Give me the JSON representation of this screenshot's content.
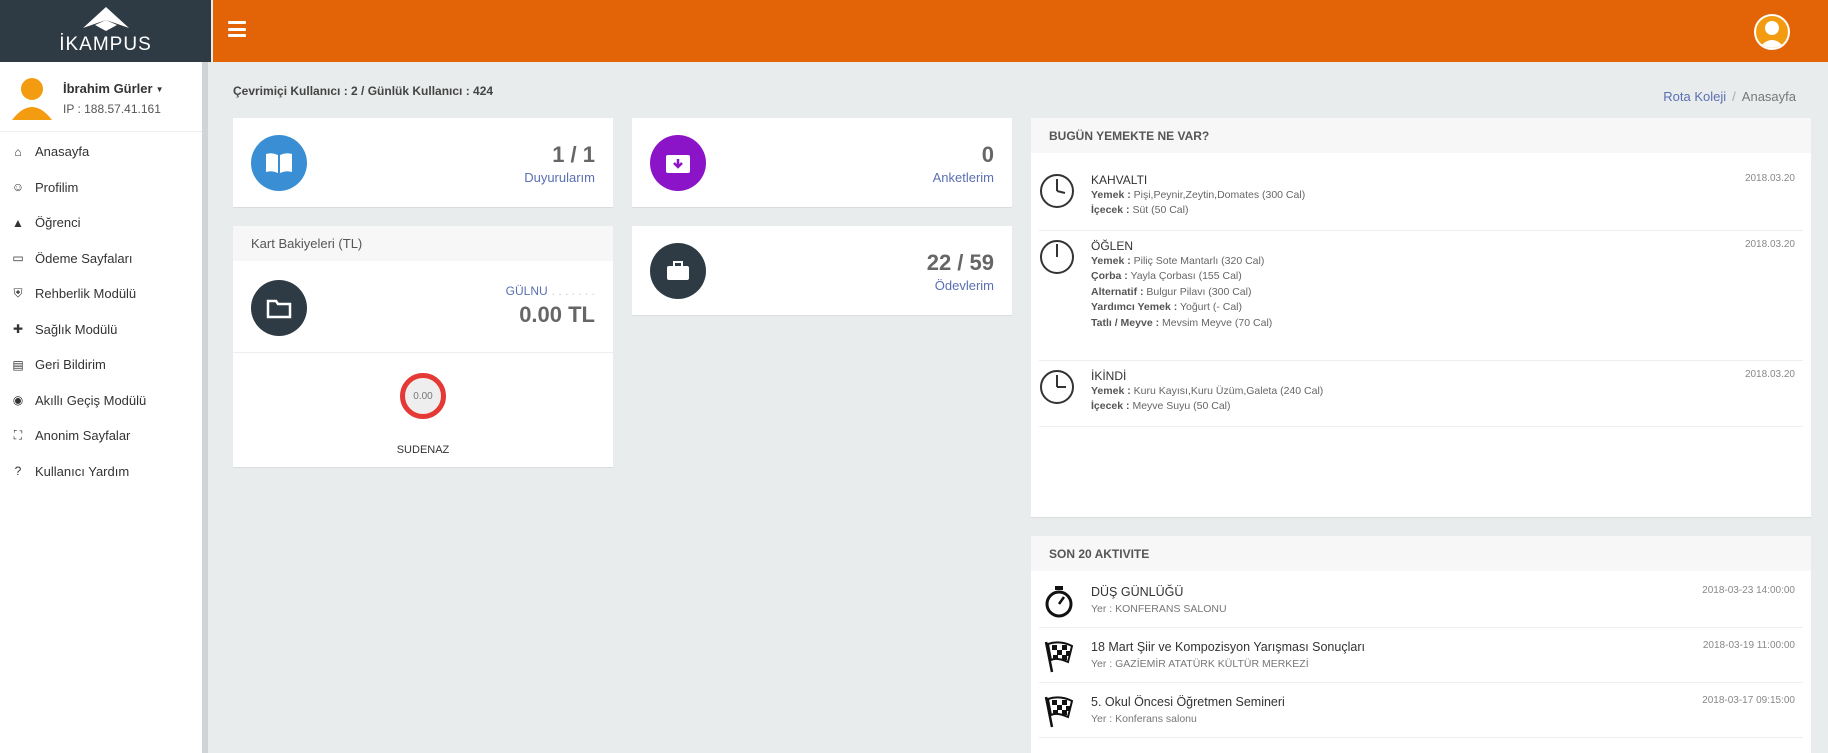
{
  "header": {
    "logo_text": "İKAMPUS",
    "brand_color": "#e36406"
  },
  "user": {
    "name": "İbrahim Gürler",
    "ip": "IP : 188.57.41.161"
  },
  "menu": [
    {
      "label": "Anasayfa",
      "icon": "home-icon"
    },
    {
      "label": "Profilim",
      "icon": "smiley-icon"
    },
    {
      "label": "Öğrenci",
      "icon": "graduation-cap-icon"
    },
    {
      "label": "Ödeme Sayfaları",
      "icon": "credit-card-icon"
    },
    {
      "label": "Rehberlik Modülü",
      "icon": "shield-check-icon"
    },
    {
      "label": "Sağlık Modülü",
      "icon": "bandage-icon"
    },
    {
      "label": "Geri Bildirim",
      "icon": "notebook-icon"
    },
    {
      "label": "Akıllı Geçiş Modülü",
      "icon": "compass-icon"
    },
    {
      "label": "Anonim Sayfalar",
      "icon": "expand-icon"
    },
    {
      "label": "Kullanıcı Yardım",
      "icon": "question-circle-icon"
    }
  ],
  "online_users": "Çevrimiçi Kullanıcı : 2 / Günlük Kullanıcı : 424",
  "breadcrumb": {
    "school": "Rota Koleji",
    "page": "Anasayfa"
  },
  "stats": {
    "announcements": {
      "value": "1 / 1",
      "label": "Duyurularım",
      "color": "#3a8fd4"
    },
    "surveys": {
      "value": "0",
      "label": "Anketlerim",
      "color": "#8b14c9"
    },
    "homework": {
      "value": "22 / 59",
      "label": "Ödevlerim",
      "color": "#2f3b44"
    }
  },
  "card_balance": {
    "title": "Kart Bakiyeleri (TL)",
    "student_first": "GÜLNU",
    "amount": "0.00 TL",
    "gauge_value": "0.00",
    "gauge_student": "SUDENAZ"
  },
  "meals": {
    "title": "BUGÜN YEMEKTE NE VAR?",
    "items": [
      {
        "title": "KAHVALTI",
        "date": "2018.03.20",
        "lines": [
          {
            "k": "Yemek :",
            "v": "Pişi,Peynir,Zeytin,Domates (300 Cal)"
          },
          {
            "k": "İçecek :",
            "v": "Süt (50 Cal)"
          }
        ]
      },
      {
        "title": "ÖĞLEN",
        "date": "2018.03.20",
        "lines": [
          {
            "k": "Yemek :",
            "v": "Piliç Sote Mantarlı (320 Cal)"
          },
          {
            "k": "Çorba :",
            "v": "Yayla Çorbası (155 Cal)"
          },
          {
            "k": "Alternatif :",
            "v": "Bulgur Pilavı (300 Cal)"
          },
          {
            "k": "Yardımcı Yemek :",
            "v": "Yoğurt (- Cal)"
          },
          {
            "k": "Tatlı / Meyve :",
            "v": "Mevsim Meyve (70 Cal)"
          }
        ]
      },
      {
        "title": "İKİNDİ",
        "date": "2018.03.20",
        "lines": [
          {
            "k": "Yemek :",
            "v": "Kuru Kayısı,Kuru Üzüm,Galeta (240 Cal)"
          },
          {
            "k": "İçecek :",
            "v": "Meyve Suyu (50 Cal)"
          }
        ]
      }
    ]
  },
  "activities": {
    "title": "SON 20 AKTIVITE",
    "items": [
      {
        "title": "DÜŞ GÜNLÜĞÜ",
        "place": "Yer : KONFERANS SALONU",
        "date": "2018-03-23 14:00:00",
        "icon": "stopwatch-icon"
      },
      {
        "title": "18 Mart Şiir ve Kompozisyon Yarışması Sonuçları",
        "place": "Yer : GAZİEMİR ATATÜRK KÜLTÜR MERKEZİ",
        "date": "2018-03-19 11:00:00",
        "icon": "checkered-flag-icon"
      },
      {
        "title": "5. Okul Öncesi Öğretmen Semineri",
        "place": "Yer : Konferans salonu",
        "date": "2018-03-17 09:15:00",
        "icon": "checkered-flag-icon"
      }
    ]
  }
}
